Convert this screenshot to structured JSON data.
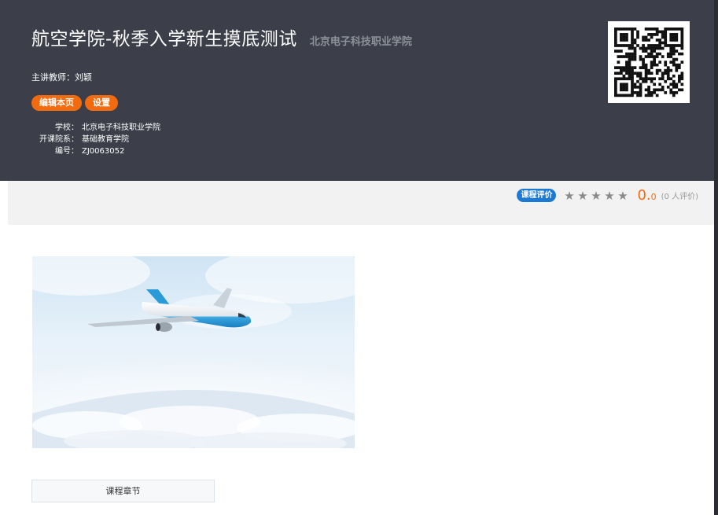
{
  "course": {
    "title": "航空学院-秋季入学新生摸底测试",
    "school_subtitle": "北京电子科技职业学院",
    "teacher_line": "主讲教师：刘颖"
  },
  "actions": {
    "edit_label": "编辑本页",
    "settings_label": "设置"
  },
  "info": [
    {
      "key": "学校：",
      "value": "北京电子科技职业学院"
    },
    {
      "key": "开课院系：",
      "value": "基础教育学院"
    },
    {
      "key": "编号：",
      "value": "ZJ0063052"
    }
  ],
  "rating": {
    "tag": "课程评价",
    "stars": 5,
    "score_int": "0.",
    "score_dec": "0",
    "count": "(0 人评价)"
  },
  "tabs": {
    "chapters_label": "课程章节"
  },
  "colors": {
    "header_bg": "#3c3f4a",
    "accent_orange": "#f26b0f",
    "tag_blue": "#1c7ad3"
  }
}
